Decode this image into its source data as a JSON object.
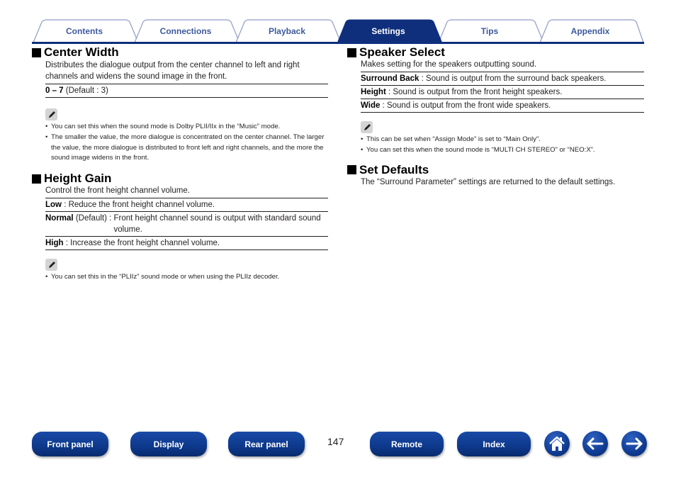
{
  "tabs": [
    {
      "label": "Contents",
      "active": false
    },
    {
      "label": "Connections",
      "active": false
    },
    {
      "label": "Playback",
      "active": false
    },
    {
      "label": "Settings",
      "active": true
    },
    {
      "label": "Tips",
      "active": false
    },
    {
      "label": "Appendix",
      "active": false
    }
  ],
  "colors": {
    "accent": "#0f2f7d",
    "tab_text": "#3d5a9e",
    "tab_outline": "#8f9cc4",
    "note_icon_bg": "#d4d4d4"
  },
  "center_width": {
    "title": "Center Width",
    "description": "Distributes the dialogue output from the center channel to left and right channels and widens the sound image in the front.",
    "options": [
      {
        "key": "0 – 7",
        "text": " (Default : 3)"
      }
    ],
    "notes": [
      "You can set this when the sound mode is Dolby PLII/IIx in the “Music” mode.",
      "The smaller the value, the more dialogue is concentrated on the center channel. The larger the value, the more dialogue is distributed to front left and right channels, and the more the sound image widens in the front."
    ]
  },
  "height_gain": {
    "title": "Height Gain",
    "description": "Control the front height channel volume.",
    "options": [
      {
        "key": "Low",
        "text": " : Reduce the front height channel volume."
      },
      {
        "key": "Normal",
        "text": " (Default) : ",
        "hang": "Front height channel sound is output with standard sound volume."
      },
      {
        "key": "High",
        "text": " : Increase the front height channel volume."
      }
    ],
    "notes": [
      "You can set this in the “PLIIz” sound mode or when using the PLIIz decoder."
    ]
  },
  "speaker_select": {
    "title": "Speaker Select",
    "description": "Makes setting for the speakers outputting sound.",
    "options": [
      {
        "key": "Surround Back",
        "text": " : Sound is output from the surround back speakers."
      },
      {
        "key": "Height",
        "text": " : Sound is output from the front height speakers."
      },
      {
        "key": "Wide",
        "text": " : Sound is output from the front wide speakers."
      }
    ],
    "notes": [
      "This can be set when “Assign Mode” is set to “Main Only”.",
      "You can set this when the sound mode is “MULTI CH STEREO” or “NEO:X”."
    ]
  },
  "set_defaults": {
    "title": "Set Defaults",
    "description": "The “Surround Parameter” settings are returned to the default settings."
  },
  "footer": {
    "buttons": [
      "Front panel",
      "Display",
      "Rear panel",
      "Remote",
      "Index"
    ],
    "page_number": "147",
    "icons": [
      "home-icon",
      "back-arrow-icon",
      "forward-arrow-icon"
    ]
  }
}
